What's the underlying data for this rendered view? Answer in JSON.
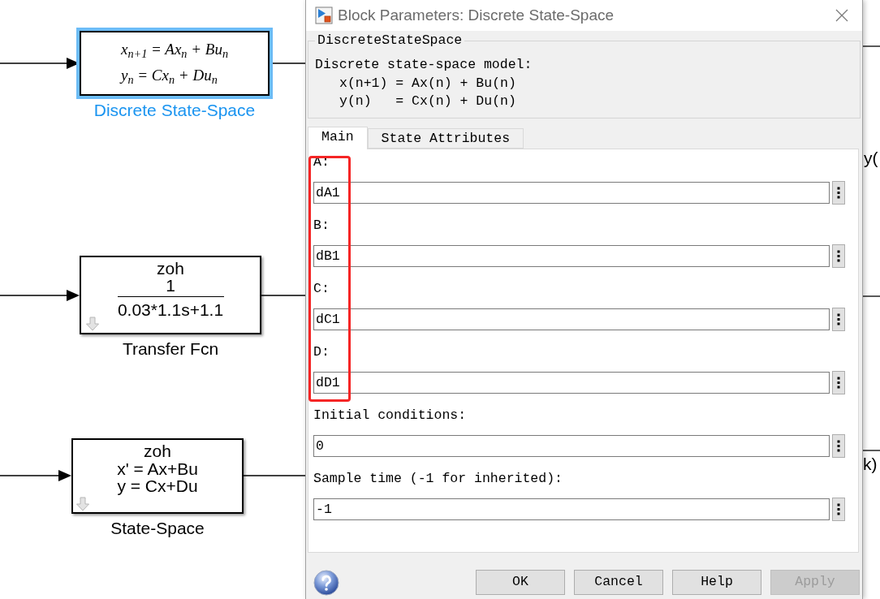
{
  "canvas": {
    "blocks": [
      {
        "kind": "equations",
        "lines": [
          "x$_{n+1}$ = Ax$_{n}$ + Bu$_{n}$",
          "y$_{n}$ = Cx$_{n}$ + Du$_{n}$"
        ],
        "name": "Discrete State-Space",
        "selected": true,
        "discretized": false
      },
      {
        "kind": "transfer_function",
        "header": "zoh",
        "numerator": "1",
        "denominator": "0.03*1.1s+1.1",
        "name": "Transfer Fcn",
        "selected": false,
        "discretized": true
      },
      {
        "kind": "text_lines",
        "lines": [
          "zoh",
          "x' = Ax+Bu",
          "y = Cx+Du"
        ],
        "name": "State-Space",
        "selected": false,
        "discretized": true
      }
    ],
    "line_labels": [
      "y(",
      "k)"
    ]
  },
  "dialog": {
    "title": "Block Parameters: Discrete State-Space",
    "group": {
      "legend": "DiscreteStateSpace",
      "heading": "Discrete state-space model:",
      "equations": [
        "x(n+1) = Ax(n) + Bu(n)",
        "y(n)   = Cx(n) + Du(n)"
      ]
    },
    "tabs": [
      {
        "label": "Main",
        "selected": true
      },
      {
        "label": "State Attributes",
        "selected": false
      }
    ],
    "parameters": [
      {
        "label": "A:",
        "value": "dA1",
        "highlighted": true
      },
      {
        "label": "B:",
        "value": "dB1",
        "highlighted": true
      },
      {
        "label": "C:",
        "value": "dC1",
        "highlighted": true
      },
      {
        "label": "D:",
        "value": "dD1",
        "highlighted": true
      },
      {
        "label": "Initial conditions:",
        "value": "0",
        "highlighted": false
      },
      {
        "label": "Sample time (-1 for inherited):",
        "value": "-1",
        "highlighted": false
      }
    ],
    "buttons": [
      {
        "label": "OK",
        "disabled": false
      },
      {
        "label": "Cancel",
        "disabled": false
      },
      {
        "label": "Help",
        "disabled": false
      },
      {
        "label": "Apply",
        "disabled": true
      }
    ]
  }
}
